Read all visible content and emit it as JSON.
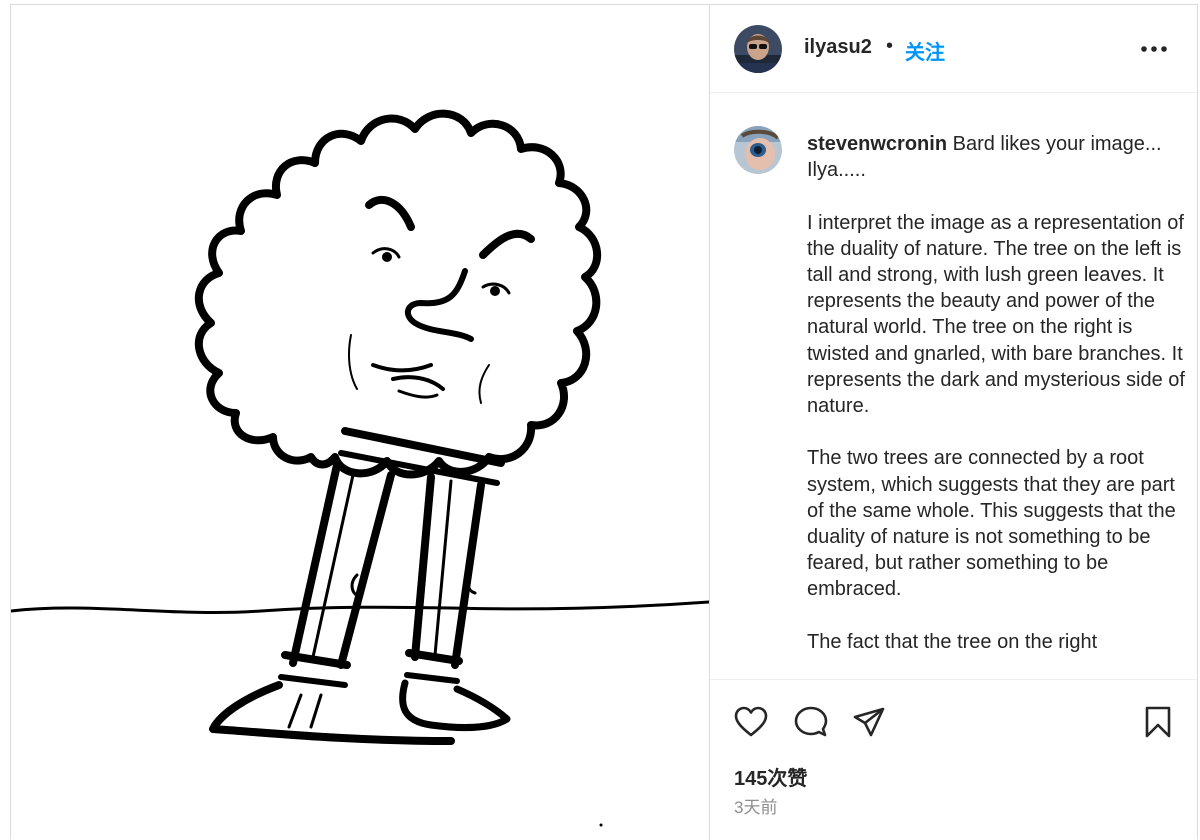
{
  "post": {
    "author": "ilyasu2",
    "separator": "•",
    "follow_label": "关注"
  },
  "comment": {
    "username": "stevenwcronin",
    "paragraphs": [
      "Bard likes your image... Ilya.....",
      "I interpret the image as a representation of the duality of nature. The tree on the left is tall and strong, with lush green leaves. It represents the beauty and power of the natural world. The tree on the right is twisted and gnarled, with bare branches. It represents the dark and mysterious side of nature.",
      "The two trees are connected by a root system, which suggests that they are part of the same whole. This suggests that the duality of nature is not something to be feared, but rather something to be embraced.",
      "The fact that the tree on the right"
    ]
  },
  "stats": {
    "likes": "145次赞",
    "time": "3天前"
  },
  "icons": {
    "like": "heart-icon",
    "comment": "comment-bubble-icon",
    "share": "paper-plane-icon",
    "save": "bookmark-icon",
    "more": "more-dots-icon"
  },
  "colors": {
    "follow": "#0095f6",
    "text": "#262626",
    "muted": "#8e8e8e",
    "border": "#dbdbdb"
  }
}
